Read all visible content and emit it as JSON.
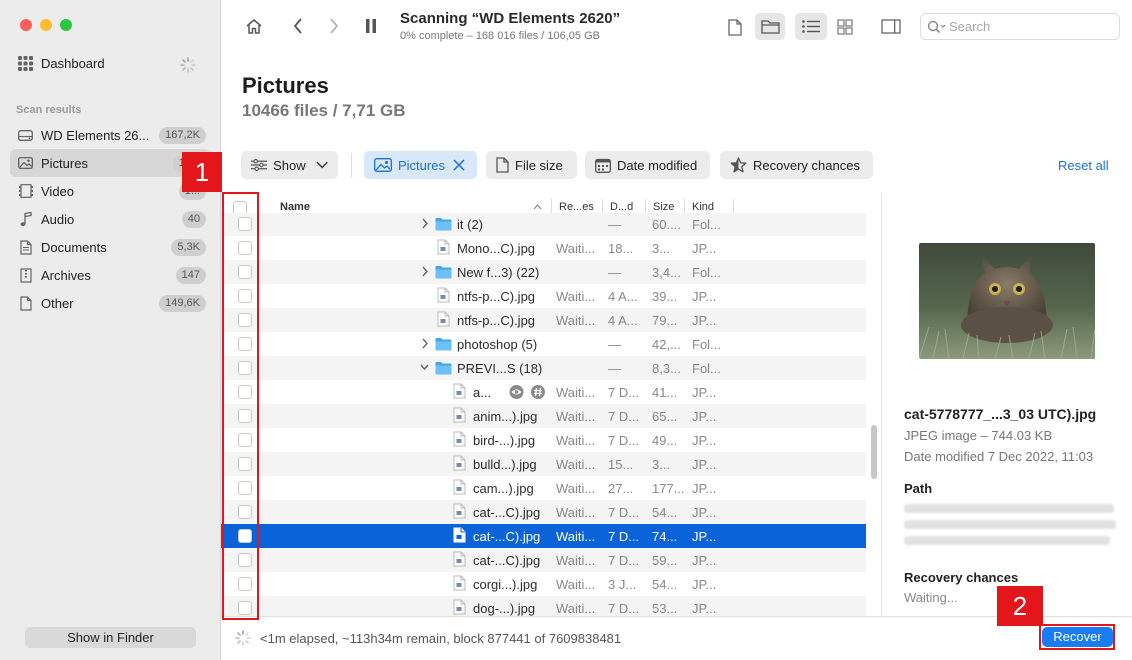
{
  "sidebar": {
    "dashboard_label": "Dashboard",
    "section_label": "Scan results",
    "items": [
      {
        "label": "WD Elements 26...",
        "count": "167,2K",
        "icon": "drive-icon"
      },
      {
        "label": "Pictures",
        "count": "10...",
        "icon": "image-icon"
      },
      {
        "label": "Video",
        "count": "1...",
        "icon": "video-icon"
      },
      {
        "label": "Audio",
        "count": "40",
        "icon": "music-note-icon"
      },
      {
        "label": "Documents",
        "count": "5,3K",
        "icon": "document-icon"
      },
      {
        "label": "Archives",
        "count": "147",
        "icon": "archive-icon"
      },
      {
        "label": "Other",
        "count": "149,6K",
        "icon": "file-icon"
      }
    ],
    "show_in_finder": "Show in Finder"
  },
  "toolbar": {
    "title": "Scanning “WD Elements 2620”",
    "subtitle": "0% complete – 168 016 files / 106,05 GB",
    "search_placeholder": "Search"
  },
  "header": {
    "title": "Pictures",
    "subtitle": "10466 files / 7,71 GB"
  },
  "filters": {
    "show": "Show",
    "pictures": "Pictures",
    "file_size": "File size",
    "date_modified": "Date modified",
    "recovery_chances": "Recovery chances",
    "reset_all": "Reset all"
  },
  "columns": {
    "name": "Name",
    "recovery": "Re...es",
    "date": "D...d",
    "size": "Size",
    "kind": "Kind"
  },
  "rows": [
    {
      "name": "it (2)",
      "type": "folder",
      "level": 1,
      "recovery": "",
      "date": "—",
      "size": "60....",
      "kind": "Fol..."
    },
    {
      "name": "Mono...C).jpg",
      "type": "file",
      "level": 1,
      "recovery": "Waiti...",
      "date": "18...",
      "size": "3...",
      "kind": "JP..."
    },
    {
      "name": "New f...3) (22)",
      "type": "folder",
      "level": 1,
      "recovery": "",
      "date": "—",
      "size": "3,4...",
      "kind": "Fol..."
    },
    {
      "name": "ntfs-p...C).jpg",
      "type": "file",
      "level": 1,
      "recovery": "Waiti...",
      "date": "4 A...",
      "size": "39...",
      "kind": "JP..."
    },
    {
      "name": "ntfs-p...C).jpg",
      "type": "file",
      "level": 1,
      "recovery": "Waiti...",
      "date": "4 A...",
      "size": "79...",
      "kind": "JP..."
    },
    {
      "name": "photoshop (5)",
      "type": "folder",
      "level": 1,
      "recovery": "",
      "date": "—",
      "size": "42,...",
      "kind": "Fol..."
    },
    {
      "name": "PREVI...S (18)",
      "type": "folder-open",
      "level": 1,
      "recovery": "",
      "date": "—",
      "size": "8,3...",
      "kind": "Fol..."
    },
    {
      "name": "a...",
      "type": "file-hover",
      "level": 2,
      "recovery": "Waiti...",
      "date": "7 D...",
      "size": "41...",
      "kind": "JP..."
    },
    {
      "name": "anim...).jpg",
      "type": "file",
      "level": 2,
      "recovery": "Waiti...",
      "date": "7 D...",
      "size": "65...",
      "kind": "JP..."
    },
    {
      "name": "bird-...).jpg",
      "type": "file",
      "level": 2,
      "recovery": "Waiti...",
      "date": "7 D...",
      "size": "49...",
      "kind": "JP..."
    },
    {
      "name": "bulld...).jpg",
      "type": "file",
      "level": 2,
      "recovery": "Waiti...",
      "date": "15...",
      "size": "3...",
      "kind": "JP..."
    },
    {
      "name": "cam...).jpg",
      "type": "file",
      "level": 2,
      "recovery": "Waiti...",
      "date": "27...",
      "size": "177...",
      "kind": "JP..."
    },
    {
      "name": "cat-...C).jpg",
      "type": "file",
      "level": 2,
      "recovery": "Waiti...",
      "date": "7 D...",
      "size": "54...",
      "kind": "JP..."
    },
    {
      "name": "cat-...C).jpg",
      "type": "file",
      "level": 2,
      "recovery": "Waiti...",
      "date": "7 D...",
      "size": "74...",
      "kind": "JP...",
      "selected": true
    },
    {
      "name": "cat-...C).jpg",
      "type": "file",
      "level": 2,
      "recovery": "Waiti...",
      "date": "7 D...",
      "size": "59...",
      "kind": "JP..."
    },
    {
      "name": "corgi...).jpg",
      "type": "file",
      "level": 2,
      "recovery": "Waiti...",
      "date": "3 J...",
      "size": "54...",
      "kind": "JP..."
    },
    {
      "name": "dog-...).jpg",
      "type": "file",
      "level": 2,
      "recovery": "Waiti...",
      "date": "7 D...",
      "size": "53...",
      "kind": "JP..."
    }
  ],
  "preview": {
    "file_name": "cat-5778777_...3_03 UTC).jpg",
    "type_size": "JPEG image – 744.03 KB",
    "date_modified": "Date modified  7 Dec 2022, 11:03",
    "path_label": "Path",
    "recovery_label": "Recovery chances",
    "recovery_value": "Waiting..."
  },
  "footer": {
    "status": "<1m elapsed, ~113h34m remain, block 877441 of 7609838481",
    "recover_label": "Recover"
  },
  "annotations": {
    "one": "1",
    "two": "2"
  },
  "colors": {
    "accent": "#1a7cf2",
    "selection": "#0a63d8",
    "annotation": "#e3161c"
  }
}
